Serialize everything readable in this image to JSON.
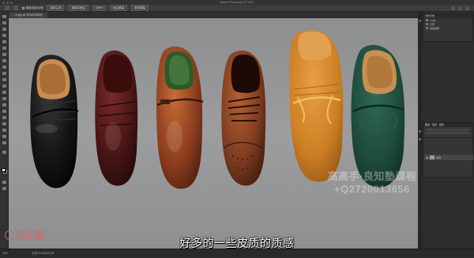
{
  "window": {
    "title": "Adobe Photoshop CC 2019"
  },
  "options_bar": {
    "items": [
      "调整边缘/区域",
      "选择主体",
      "选择并遮住",
      "100%",
      "适合屏幕",
      "填充屏幕"
    ]
  },
  "document": {
    "tab_title": "1f.jpg @ 25%(RGB/8*)"
  },
  "history_panel": {
    "title": "历史记录",
    "file_name": "1f.jpg",
    "items": [
      "打开",
      "快速选择"
    ]
  },
  "layers_panel": {
    "tabs": [
      "图层",
      "通道",
      "路径"
    ],
    "layer_name": "背景"
  },
  "canvas": {
    "watermark_line1": "高高手·良知塾课程",
    "watermark_line2": "+Q2720013656"
  },
  "statusbar": {
    "zoom": "25%",
    "doc_size": "文档:33.0M/33.0M"
  },
  "logo": {
    "text": "良知塾"
  },
  "subtitle": "好多的一些皮质的质感",
  "colors": {
    "canvas_bg": "#9a9b9d",
    "ui_dark": "#323232",
    "shoe_black": "#151515",
    "shoe_burgundy": "#4a1a1a",
    "shoe_cognac": "#8a3d1e",
    "shoe_brown": "#7a3a20",
    "shoe_suede_orange": "#d08426",
    "shoe_green_suede": "#1f4a3a"
  }
}
